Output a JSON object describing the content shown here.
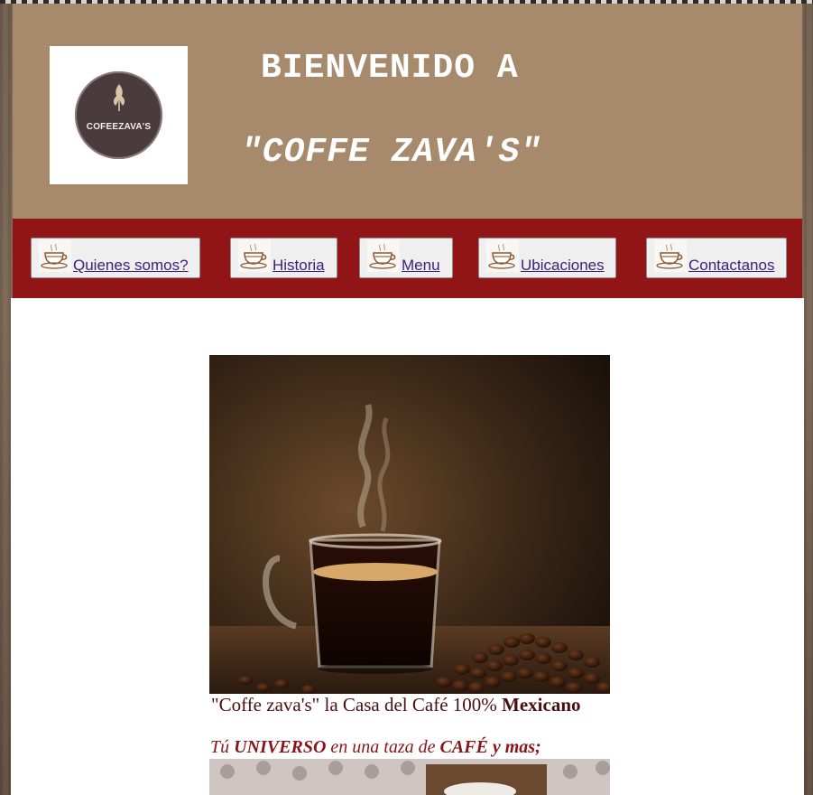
{
  "header": {
    "logo": {
      "text": "COFEEZAVA'S",
      "icon": "coffee-leaf-logo"
    },
    "title_line1": "BIENVENIDO A",
    "title_line2": "\"COFFE ZAVA'S\""
  },
  "nav": {
    "items": [
      {
        "label": " Quienes somos?",
        "icon": "coffee-cup-icon"
      },
      {
        "label": " Historia",
        "icon": "coffee-cup-icon"
      },
      {
        "label": " Menu",
        "icon": "coffee-cup-icon"
      },
      {
        "label": " Ubicaciones",
        "icon": "coffee-cup-icon"
      },
      {
        "label": " Contactanos",
        "icon": "coffee-cup-icon"
      }
    ]
  },
  "main": {
    "hero_image": "coffee-cup-with-beans-photo",
    "caption_text": "\"Coffe zava's\" la Casa del Café 100% ",
    "caption_bold": "Mexicano",
    "tagline": {
      "p1": "Tú ",
      "b1": "UNIVERSO",
      "p2": " en una taza de ",
      "b2": "CAFÉ y mas;"
    },
    "second_image": "coffee-latte-photo"
  },
  "colors": {
    "header_bg": "#a68a6b",
    "nav_bg": "#911417",
    "link": "#3b1f7a",
    "caption": "#4a0f12",
    "tagline": "#8a1519"
  }
}
